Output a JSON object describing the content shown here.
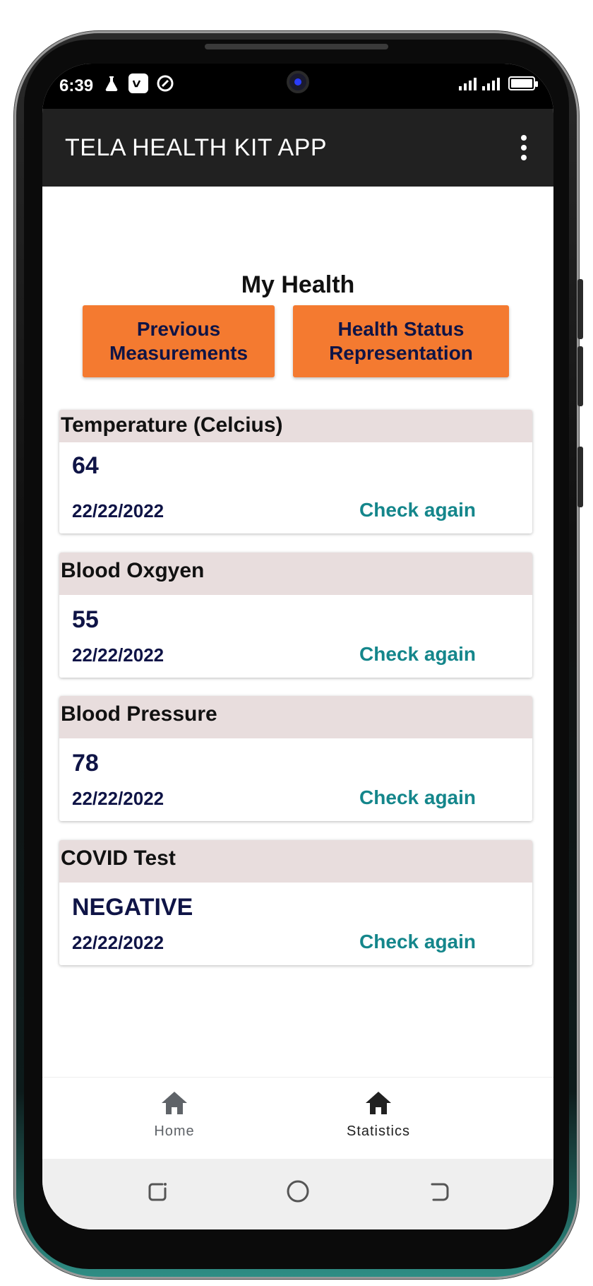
{
  "statusbar": {
    "time": "6:39"
  },
  "appbar": {
    "title": "TELA HEALTH KIT APP"
  },
  "main": {
    "section_title": "My Health",
    "buttons": {
      "previous_line1": "Previous",
      "previous_line2": "Measurements",
      "status_line1": "Health Status",
      "status_line2": "Representation"
    },
    "cards": [
      {
        "title": "Temperature (Celcius)",
        "value": "64",
        "date": "22/22/2022",
        "action": "Check again"
      },
      {
        "title": "Blood Oxgyen",
        "value": "55",
        "date": "22/22/2022",
        "action": "Check again"
      },
      {
        "title": "Blood Pressure",
        "value": "78",
        "date": "22/22/2022",
        "action": "Check again"
      },
      {
        "title": "COVID Test",
        "value": "NEGATIVE",
        "date": "22/22/2022",
        "action": "Check again"
      }
    ]
  },
  "bottom_nav": {
    "items": [
      {
        "label": "Home",
        "icon": "home-icon",
        "active": false
      },
      {
        "label": "Statistics",
        "icon": "home-icon",
        "active": true
      }
    ]
  },
  "colors": {
    "accent_button": "#f47a30",
    "link": "#14868b",
    "value_text": "#0f1446",
    "card_header": "#e8dddd",
    "appbar": "#212121"
  }
}
